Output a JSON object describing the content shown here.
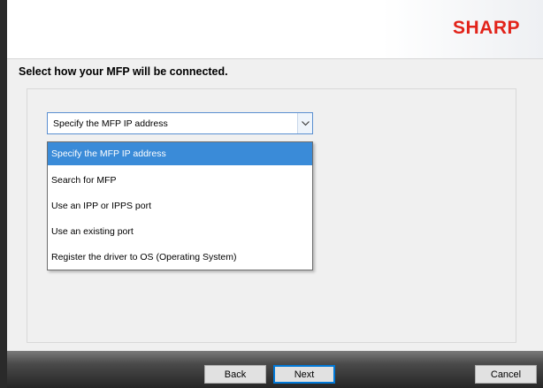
{
  "header": {
    "logo_text": "SHARP"
  },
  "instruction": "Select how your MFP will be connected.",
  "connection_select": {
    "selected_value": "Specify the MFP IP address",
    "options": [
      "Specify the MFP IP address",
      "Search for MFP",
      "Use an IPP or IPPS port",
      "Use an existing port",
      "Register the driver to OS (Operating System)"
    ],
    "highlighted_index": 0
  },
  "footer": {
    "back_label": "Back",
    "next_label": "Next",
    "cancel_label": "Cancel"
  },
  "colors": {
    "brand_red": "#e2231a",
    "highlight_blue": "#3a8bd8"
  }
}
